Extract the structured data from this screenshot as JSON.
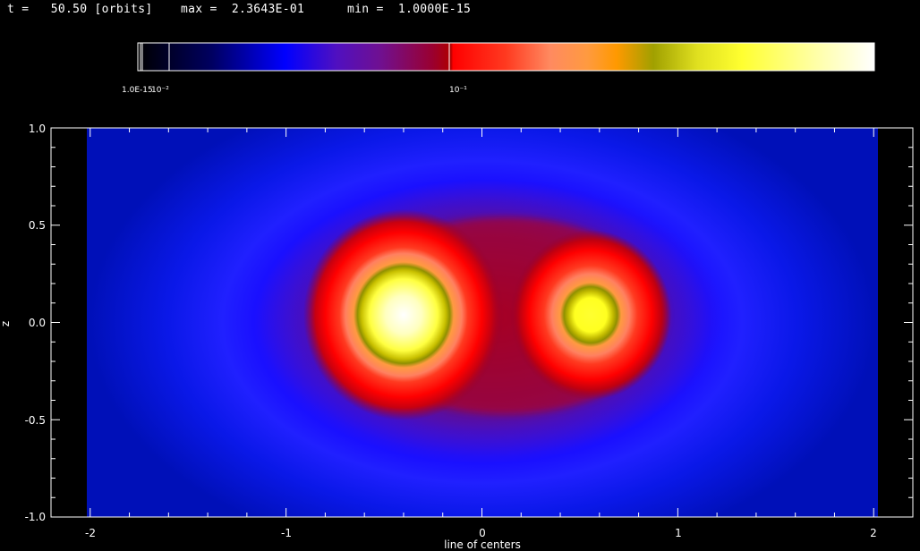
{
  "header": {
    "time": "t =   50.50 [orbits]",
    "max": "max =  2.3643E-01",
    "min": "min =  1.0000E-15"
  },
  "colorbar": {
    "tick_labels": [
      "1.0E-15",
      "10⁻²",
      "10⁻¹"
    ],
    "tick_values": [
      1e-15,
      0.01,
      0.1
    ],
    "colors": [
      "#000000",
      "#000050",
      "#0000ff",
      "#7a10a0",
      "#cc0000",
      "#ff2200",
      "#ff8a60",
      "#ff9900",
      "#a0a000",
      "#ffff30",
      "#ffffff"
    ],
    "scale": "log"
  },
  "chart_data": {
    "type": "heatmap",
    "title": "",
    "xlabel": "line of centers",
    "ylabel": "z",
    "xlim": [
      -2.2,
      2.2
    ],
    "ylim": [
      -1.0,
      1.0
    ],
    "x_ticks": [
      "-2",
      "-1",
      "0",
      "1",
      "2"
    ],
    "x_tick_values": [
      -2,
      -1,
      0,
      1,
      2
    ],
    "y_ticks": [
      "-1.0",
      "-0.5",
      "0.0",
      "0.5",
      "1.0"
    ],
    "y_tick_values": [
      -1.0,
      -0.5,
      0.0,
      0.5,
      1.0
    ],
    "data_extent_x": [
      -2.02,
      2.02
    ],
    "max": 0.23643,
    "min": 1e-15,
    "peaks": [
      {
        "x": -0.4,
        "z": 0.03,
        "value": 0.2364
      },
      {
        "x": 0.55,
        "z": 0.03,
        "value": 0.18
      }
    ],
    "colormap": [
      "#000000",
      "#000050",
      "#0000ff",
      "#7a10a0",
      "#cc0000",
      "#ff2200",
      "#ff8a60",
      "#ff9900",
      "#a0a000",
      "#ffff30",
      "#ffffff"
    ]
  }
}
